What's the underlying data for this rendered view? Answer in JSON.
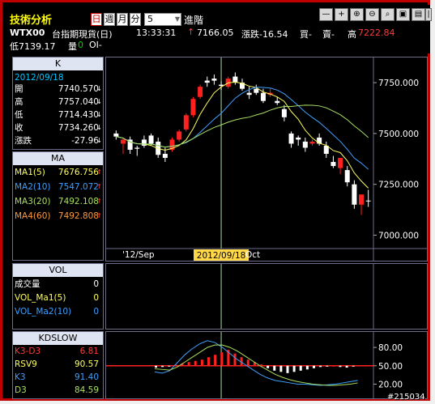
{
  "toolbar": {
    "title": "技術分析",
    "period_day": "日",
    "period_week": "週",
    "period_month": "月",
    "period_minute": "分",
    "interval_value": "5",
    "advanced": "進階",
    "icons": [
      "minus-icon",
      "plus-icon",
      "zoom-in-icon",
      "zoom-out-icon",
      "search-icon",
      "save-icon",
      "print-icon",
      "help-icon"
    ]
  },
  "quote": {
    "symbol": "WTX00",
    "name": "台指期現貨(日)",
    "time": "13:33:31",
    "price": "7166.05",
    "change": "漲跌-16.54",
    "buy": "買-",
    "sell": "賣-",
    "high_label": "高",
    "high": "7222.84",
    "low": "低7139.17",
    "vol_label": "量",
    "vol": "0",
    "oi": "OI-"
  },
  "k_panel": {
    "title": "K",
    "date": "2012/09/18",
    "rows": [
      {
        "label": "開",
        "value": "7740.570",
        "dir": "down"
      },
      {
        "label": "高",
        "value": "7757.040",
        "dir": "down"
      },
      {
        "label": "低",
        "value": "7714.430",
        "dir": "down"
      },
      {
        "label": "收",
        "value": "7734.260",
        "dir": "down"
      },
      {
        "label": "漲跌",
        "value": "-27.96",
        "dir": "down"
      }
    ]
  },
  "ma_panel": {
    "title": "MA",
    "rows": [
      {
        "label": "MA1(5)",
        "value": "7676.756",
        "color": "#ffff60",
        "dir": "up"
      },
      {
        "label": "MA2(10)",
        "value": "7547.072",
        "color": "#3da0ff",
        "dir": "up"
      },
      {
        "label": "MA3(20)",
        "value": "7492.108",
        "color": "#a8e060",
        "dir": "up"
      },
      {
        "label": "MA4(60)",
        "value": "7492.808",
        "color": "#ff9a3a",
        "dir": "up"
      }
    ]
  },
  "vol_panel": {
    "title": "VOL",
    "rows": [
      {
        "label": "成交量",
        "value": "0",
        "color": "#ffffff"
      },
      {
        "label": "VOL_Ma1(5)",
        "value": "0",
        "color": "#ffff60"
      },
      {
        "label": "VOL_Ma2(10)",
        "value": "0",
        "color": "#3da0ff"
      }
    ]
  },
  "kd_panel": {
    "title": "KDSLOW",
    "rows": [
      {
        "label": "K3-D3",
        "value": "6.81",
        "color": "#ff3b3b"
      },
      {
        "label": "RSV9",
        "value": "90.57",
        "color": "#ffff60"
      },
      {
        "label": "K3",
        "value": "91.40",
        "color": "#3da0ff"
      },
      {
        "label": "D3",
        "value": "84.59",
        "color": "#a8e060"
      }
    ]
  },
  "price_axis": [
    "7750.000",
    "7500.000",
    "7250.000",
    "7000.000"
  ],
  "kd_axis": [
    "80.00",
    "50.00",
    "20.00"
  ],
  "time_axis": {
    "sep": "'12/Sep",
    "cursor": "2012/09/18",
    "oct": "Oct"
  },
  "watermark": "#215034",
  "colors": {
    "up": "#ff2020",
    "down": "#ffffff",
    "ma1": "#ffff60",
    "ma2": "#3da0ff",
    "ma3": "#a8e060",
    "cursor": "#a8e0a8"
  },
  "chart_data": {
    "type": "candlestick",
    "ylim": [
      6950,
      7850
    ],
    "candles": [
      {
        "o": 7500,
        "h": 7515,
        "l": 7470,
        "c": 7485
      },
      {
        "o": 7450,
        "h": 7480,
        "l": 7400,
        "c": 7470
      },
      {
        "o": 7470,
        "h": 7485,
        "l": 7400,
        "c": 7420
      },
      {
        "o": 7430,
        "h": 7440,
        "l": 7390,
        "c": 7425
      },
      {
        "o": 7470,
        "h": 7490,
        "l": 7430,
        "c": 7440
      },
      {
        "o": 7490,
        "h": 7500,
        "l": 7440,
        "c": 7450
      },
      {
        "o": 7460,
        "h": 7480,
        "l": 7380,
        "c": 7395
      },
      {
        "o": 7400,
        "h": 7430,
        "l": 7360,
        "c": 7380
      },
      {
        "o": 7420,
        "h": 7480,
        "l": 7410,
        "c": 7470
      },
      {
        "o": 7470,
        "h": 7520,
        "l": 7460,
        "c": 7510
      },
      {
        "o": 7520,
        "h": 7600,
        "l": 7510,
        "c": 7590
      },
      {
        "o": 7590,
        "h": 7680,
        "l": 7580,
        "c": 7670
      },
      {
        "o": 7680,
        "h": 7740,
        "l": 7670,
        "c": 7730
      },
      {
        "o": 7760,
        "h": 7780,
        "l": 7730,
        "c": 7750
      },
      {
        "o": 7770,
        "h": 7790,
        "l": 7740,
        "c": 7760
      },
      {
        "o": 7740,
        "h": 7757,
        "l": 7714,
        "c": 7734
      },
      {
        "o": 7730,
        "h": 7780,
        "l": 7720,
        "c": 7770
      },
      {
        "o": 7780,
        "h": 7800,
        "l": 7740,
        "c": 7750
      },
      {
        "o": 7750,
        "h": 7770,
        "l": 7710,
        "c": 7720
      },
      {
        "o": 7700,
        "h": 7730,
        "l": 7670,
        "c": 7690
      },
      {
        "o": 7720,
        "h": 7740,
        "l": 7690,
        "c": 7700
      },
      {
        "o": 7700,
        "h": 7720,
        "l": 7650,
        "c": 7660
      },
      {
        "o": 7690,
        "h": 7720,
        "l": 7680,
        "c": 7700
      },
      {
        "o": 7660,
        "h": 7680,
        "l": 7640,
        "c": 7650
      },
      {
        "o": 7620,
        "h": 7640,
        "l": 7560,
        "c": 7580
      },
      {
        "o": 7500,
        "h": 7510,
        "l": 7430,
        "c": 7450
      },
      {
        "o": 7480,
        "h": 7490,
        "l": 7440,
        "c": 7470
      },
      {
        "o": 7460,
        "h": 7480,
        "l": 7410,
        "c": 7430
      },
      {
        "o": 7450,
        "h": 7470,
        "l": 7440,
        "c": 7460
      },
      {
        "o": 7480,
        "h": 7500,
        "l": 7440,
        "c": 7450
      },
      {
        "o": 7440,
        "h": 7460,
        "l": 7380,
        "c": 7400
      },
      {
        "o": 7360,
        "h": 7390,
        "l": 7330,
        "c": 7340
      },
      {
        "o": 7330,
        "h": 7340,
        "l": 7300,
        "c": 7380
      },
      {
        "o": 7320,
        "h": 7340,
        "l": 7240,
        "c": 7260
      },
      {
        "o": 7250,
        "h": 7270,
        "l": 7130,
        "c": 7150
      },
      {
        "o": 7150,
        "h": 7200,
        "l": 7100,
        "c": 7200
      },
      {
        "o": 7170,
        "h": 7223,
        "l": 7139,
        "c": 7166
      }
    ],
    "kd_hist": [
      -3,
      -2,
      -1,
      2,
      4,
      6,
      8,
      10,
      14,
      18,
      22,
      26,
      20,
      14,
      10,
      6,
      2,
      -4,
      -8,
      -10,
      -12,
      -10,
      -8,
      -6,
      -4,
      -2,
      -1,
      0,
      -2,
      -3,
      -1,
      1
    ],
    "kd_k": [
      40,
      38,
      42,
      55,
      68,
      78,
      86,
      91,
      88,
      80,
      70,
      60,
      52,
      44,
      36,
      30,
      26,
      24,
      22,
      20,
      20,
      19,
      18,
      19,
      20,
      22,
      24,
      26
    ],
    "kd_d": [
      45,
      44,
      43,
      48,
      56,
      64,
      72,
      80,
      84,
      84,
      80,
      74,
      66,
      58,
      50,
      43,
      36,
      31,
      27,
      24,
      22,
      20,
      19,
      18,
      18,
      19,
      20,
      22
    ]
  }
}
